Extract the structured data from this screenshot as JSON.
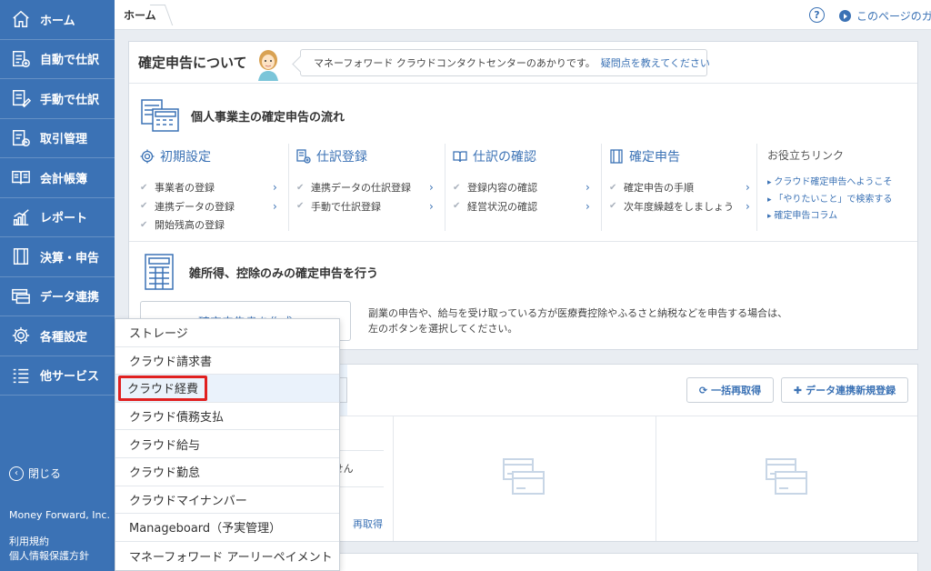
{
  "sidebar": {
    "items": [
      {
        "label": "ホーム",
        "icon": "home-icon"
      },
      {
        "label": "自動で仕訳",
        "icon": "auto-journal-icon"
      },
      {
        "label": "手動で仕訳",
        "icon": "manual-journal-icon"
      },
      {
        "label": "取引管理",
        "icon": "transaction-icon"
      },
      {
        "label": "会計帳簿",
        "icon": "ledger-book-icon"
      },
      {
        "label": "レポート",
        "icon": "report-chart-icon"
      },
      {
        "label": "決算・申告",
        "icon": "closing-icon"
      },
      {
        "label": "データ連携",
        "icon": "data-link-icon"
      },
      {
        "label": "各種設定",
        "icon": "gear-icon"
      },
      {
        "label": "他サービス",
        "icon": "list-icon"
      }
    ],
    "close_label": "閉じる",
    "brand": "Money Forward, Inc.",
    "terms": "利用規約",
    "privacy": "個人情報保護方針",
    "color": "#3b72b5"
  },
  "topbar": {
    "breadcrumb": "ホーム",
    "help_glyph": "?",
    "guide_label": "このページのガ"
  },
  "about": {
    "title": "確定申告について",
    "bubble_text": "マネーフォワード クラウドコンタクトセンターのあかりです。",
    "bubble_link": "疑問点を教えてください"
  },
  "flow": {
    "title": "個人事業主の確定申告の流れ",
    "columns": [
      {
        "title": "初期設定",
        "icon": "gear-icon",
        "items": [
          "事業者の登録",
          "連携データの登録",
          "開始残高の登録"
        ]
      },
      {
        "title": "仕訳登録",
        "icon": "journal-add-icon",
        "items": [
          "連携データの仕訳登録",
          "手動で仕訳登録"
        ]
      },
      {
        "title": "仕訳の確認",
        "icon": "book-icon",
        "items": [
          "登録内容の確認",
          "経営状況の確認"
        ]
      },
      {
        "title": "確定申告",
        "icon": "document-icon",
        "items": [
          "確定申告の手順",
          "次年度繰越をしましょう"
        ]
      }
    ],
    "links_title": "お役立ちリンク",
    "links": [
      "クラウド確定申告へようこそ",
      "「やりたいこと」で検索する",
      "確定申告コラム"
    ]
  },
  "misc": {
    "title": "雑所得、控除のみの確定申告を行う",
    "button": "確定申告書を作成",
    "desc_line1": "副業の申告や、給与を受け取っている方が医療費控除やふるさと納税などを申告する場合は、",
    "desc_line2": "左のボタンを選択してください。"
  },
  "datalink": {
    "refresh_label": "一括再取得",
    "add_label": "データ連携新規登録",
    "fragment1": "ません",
    "fragment2": "再取得"
  },
  "menu": {
    "items": [
      "ストレージ",
      "クラウド請求書",
      "クラウド経費",
      "クラウド債務支払",
      "クラウド給与",
      "クラウド勤怠",
      "クラウドマイナンバー",
      "Manageboard（予実管理）",
      "マネーフォワード アーリーペイメント"
    ],
    "highlighted_index": 2,
    "highlight_color": "#e02020"
  }
}
